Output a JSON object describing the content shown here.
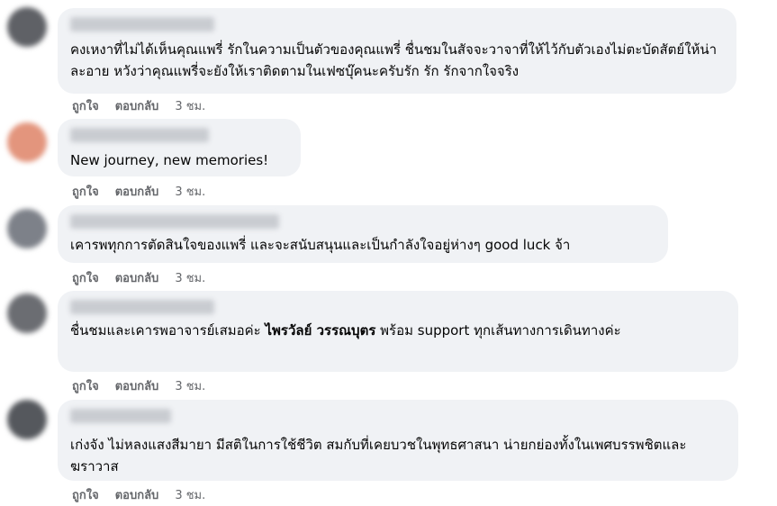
{
  "comments": [
    {
      "text": "คงเหงาที่ไม่ได้เห็นคุณแพรี่ รักในความเป็นตัวของคุณแพรี่ ชื่นชมในสัจจะวาจาที่ให้ไว้กับตัวเองไม่ตะบัดสัตย์ให้น่าละอาย หวังว่าคุณแพรี่จะยังให้เราติดตามในเฟซบุ๊คนะครับรัก รัก รักจากใจจริง",
      "like": "ถูกใจ",
      "reply": "ตอบกลับ",
      "time": "3 ชม.",
      "avatar_color": "#5f6166"
    },
    {
      "text": "New journey, new memories!",
      "like": "ถูกใจ",
      "reply": "ตอบกลับ",
      "time": "3 ชม.",
      "avatar_color": "#e3957d"
    },
    {
      "text": "เคารพทุกการตัดสินใจของแพรี่ และจะสนับสนุนและเป็นกำลังใจอยู่ห่างๆ good luck จ้า",
      "like": "ถูกใจ",
      "reply": "ตอบกลับ",
      "time": "3 ชม.",
      "avatar_color": "#7d8189"
    },
    {
      "text_before": "ชื่นชมและเคารพอาจารย์เสมอค่ะ ",
      "text_bold": "ไพรวัลย์ วรรณบุตร",
      "text_after": " พร้อม support ทุกเส้นทางการเดินทางค่ะ",
      "like": "ถูกใจ",
      "reply": "ตอบกลับ",
      "time": "3 ชม.",
      "avatar_color": "#6b6d72"
    },
    {
      "text": "เก่งจัง ไม่หลงแสงสีมายา มีสติในการใช้ชีวิต สมกับที่เคยบวชในพุทธศาสนา น่ายกย่องทั้งในเพศบรรพชิตและฆราวาส",
      "like": "ถูกใจ",
      "reply": "ตอบกลับ",
      "time": "3 ชม.",
      "avatar_color": "#55585d"
    }
  ]
}
